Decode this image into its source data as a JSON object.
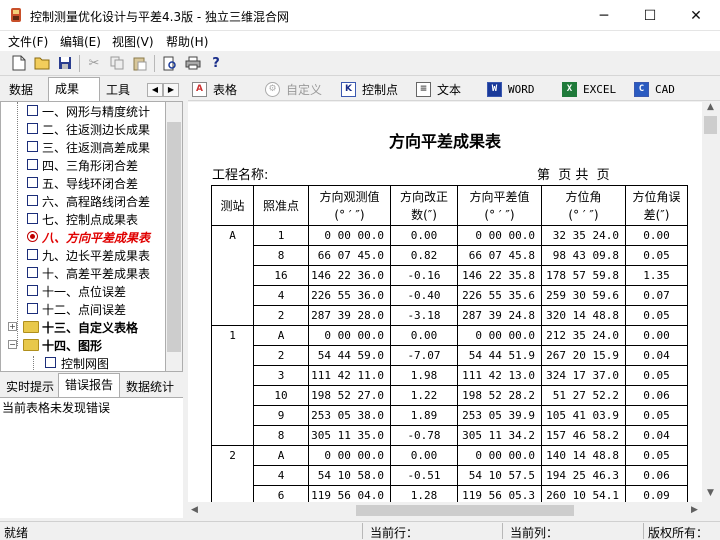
{
  "window": {
    "title": "控制测量优化设计与平差4.3版 - 独立三维混合网",
    "minimize_glyph": "─",
    "maximize_glyph": "☐",
    "close_glyph": "✕"
  },
  "menu": [
    "文件(F)",
    "编辑(E)",
    "视图(V)",
    "帮助(H)"
  ],
  "toolbar_icons": [
    "new-file-icon",
    "open-folder-icon",
    "save-icon",
    "cut-icon",
    "copy-icon",
    "paste-icon",
    "print-preview-icon",
    "print-icon",
    "help-icon"
  ],
  "left_tabs": [
    "数据",
    "成果",
    "工具"
  ],
  "tree": [
    {
      "label": "一、网形与精度统计"
    },
    {
      "label": "二、往返测边长成果"
    },
    {
      "label": "三、往返测高差成果"
    },
    {
      "label": "四、三角形闭合差"
    },
    {
      "label": "五、导线环闭合差"
    },
    {
      "label": "六、高程路线闭合差"
    },
    {
      "label": "七、控制点成果表"
    },
    {
      "label": "八、方向平差成果表"
    },
    {
      "label": "九、边长平差成果表"
    },
    {
      "label": "十、高差平差成果表"
    },
    {
      "label": "十一、点位误差"
    },
    {
      "label": "十二、点间误差"
    },
    {
      "label": "十三、自定义表格"
    },
    {
      "label": "十四、图形"
    },
    {
      "label": "控制网图"
    }
  ],
  "lower_tabs": [
    "实时提示",
    "错误报告",
    "数据统计"
  ],
  "error_message": "当前表格未发现错误",
  "right_toolbar": {
    "table": "表格",
    "custom": "自定义",
    "control_point": "控制点",
    "text": "文本",
    "word": "WORD",
    "excel": "EXCEL",
    "cad": "CAD"
  },
  "document": {
    "title": "方向平差成果表",
    "project_label": "工程名称:",
    "page_info": "第  页 共  页",
    "headers": [
      "测站",
      "照准点",
      "方向观测值\n(° ′ ″)",
      "方向改正\n数(″)",
      "方向平差值\n(° ′ ″)",
      "方位角\n(° ′ ″)",
      "方位角误\n差(″)"
    ],
    "stations": [
      {
        "name": "A",
        "rows": [
          [
            "1",
            "0 00 00.0",
            "0.00",
            "0 00 00.0",
            "32 35 24.0",
            "0.00"
          ],
          [
            "8",
            "66 07 45.0",
            "0.82",
            "66 07 45.8",
            "98 43 09.8",
            "0.05"
          ],
          [
            "16",
            "146 22 36.0",
            "-0.16",
            "146 22 35.8",
            "178 57 59.8",
            "1.35"
          ],
          [
            "4",
            "226 55 36.0",
            "-0.40",
            "226 55 35.6",
            "259 30 59.6",
            "0.07"
          ],
          [
            "2",
            "287 39 28.0",
            "-3.18",
            "287 39 24.8",
            "320 14 48.8",
            "0.05"
          ]
        ]
      },
      {
        "name": "1",
        "rows": [
          [
            "A",
            "0 00 00.0",
            "0.00",
            "0 00 00.0",
            "212 35 24.0",
            "0.00"
          ],
          [
            "2",
            "54 44 59.0",
            "-7.07",
            "54 44 51.9",
            "267 20 15.9",
            "0.04"
          ],
          [
            "3",
            "111 42 11.0",
            "1.98",
            "111 42 13.0",
            "324 17 37.0",
            "0.05"
          ],
          [
            "10",
            "198 52 27.0",
            "1.22",
            "198 52 28.2",
            "51 27 52.2",
            "0.06"
          ],
          [
            "9",
            "253 05 38.0",
            "1.89",
            "253 05 39.9",
            "105 41 03.9",
            "0.05"
          ],
          [
            "8",
            "305 11 35.0",
            "-0.78",
            "305 11 34.2",
            "157 46 58.2",
            "0.04"
          ]
        ]
      },
      {
        "name": "2",
        "rows": [
          [
            "A",
            "0 00 00.0",
            "0.00",
            "0 00 00.0",
            "140 14 48.8",
            "0.05"
          ],
          [
            "4",
            "54 10 58.0",
            "-0.51",
            "54 10 57.5",
            "194 25 46.3",
            "0.06"
          ],
          [
            "6",
            "119 56 04.0",
            "1.28",
            "119 56 05.3",
            "260 10 54.1",
            "0.09"
          ]
        ]
      }
    ]
  },
  "status": {
    "ready": "就绪",
    "row": "当前行：",
    "col": "当前列：",
    "copyright": "版权所有："
  }
}
